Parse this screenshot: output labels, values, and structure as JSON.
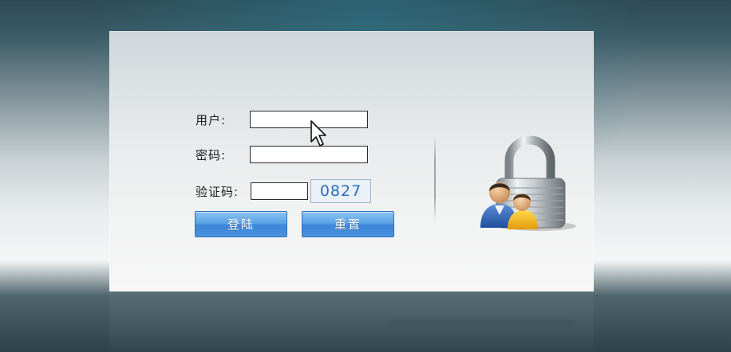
{
  "login": {
    "user_label": "用户:",
    "password_label": "密码:",
    "captcha_label": "验证码:",
    "user_value": "",
    "password_value": "",
    "captcha_value": "",
    "captcha_code": "0827",
    "login_button": "登陆",
    "reset_button": "重置"
  },
  "colors": {
    "button_blue": "#4a95df",
    "captcha_text": "#2a6fba",
    "panel_bg": "#eef0f0"
  },
  "icons": {
    "lock": "lock-users-icon",
    "cursor": "mouse-pointer-icon"
  }
}
